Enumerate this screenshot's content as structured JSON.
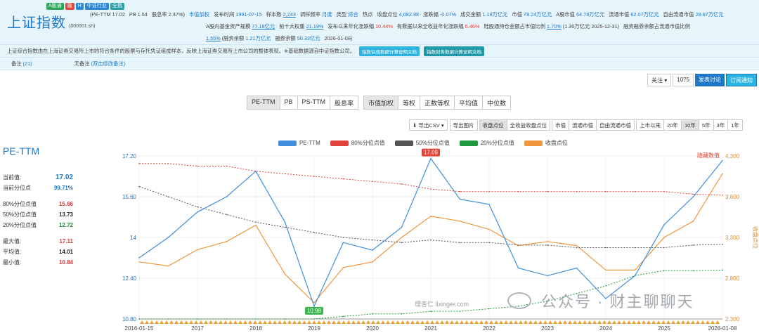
{
  "header": {
    "badges": [
      "A股通",
      "融",
      "H",
      "中证行业",
      "全指"
    ],
    "index_name": "上证指数",
    "index_code": "(000001.sh)",
    "row1": {
      "pe": "(PE-TTM 17.02",
      "pb": "PB 1.54",
      "div": "股息率 2.47%)",
      "weight": "市值加权",
      "publish_label": "发布时间",
      "publish": "1991-07-15",
      "samples_label": "样本数",
      "samples": "2,243",
      "rebal_label": "调样频率",
      "rebal": "月度",
      "type_label": "类型",
      "type": "综合",
      "hot": "热点",
      "close_label": "收盘点位",
      "close": "4,082.98",
      "chg_label": "涨跌幅",
      "chg": "-0.07%",
      "amount_label": "成交金额",
      "amount": "1.18万亿元",
      "mcap_label": "市值",
      "mcap": "78.24万亿元",
      "amcap_label": "A股市值",
      "amcap": "64.78万亿元",
      "float_label": "流通市值",
      "float": "62.07万亿元",
      "free_label": "自由流通市值",
      "free": "28.87万亿元"
    },
    "row2": {
      "fund_label": "A股内基金资产规模",
      "fund": "77.18亿元",
      "top10_label": "前十大权重",
      "top10": "21.19%",
      "annual_label": "发布以来年化涨跌幅",
      "annual": "10.44%",
      "total_label": "有数据以来全收益年化涨跌幅",
      "total": "6.46%",
      "hk_label": "陆股通持仓金额占市值比例",
      "hk": "1.70%",
      "hk_extra": "(1.30万亿元  2025-12-31)",
      "margin_label": "融资融券余额占流通市值比例"
    },
    "row3": {
      "ratio": "1.55%",
      "fin_label": "(融资余额",
      "fin": "1.21万亿元",
      "sec_label": "融券余额",
      "sec": "50.33亿元",
      "date": "2026-01-08)"
    },
    "description": "上证综合指数由在上海证券交易所上市的符合条件的股票与存托凭证组成样本，反映上海证券交易所上市公司的整体表现。※基础数据源自中证指数公司。",
    "doc_btn1": "指数估值数据计算说明文档",
    "doc_btn2": "指数财务数据计算说明文档",
    "note_label": "备注",
    "note_count": "(21)",
    "no_note_label": "无备注",
    "no_note_link": "(双击修改备注)"
  },
  "follow": {
    "label": "关注",
    "count": "1075",
    "discuss": "发表讨论",
    "subscribe": "订阅通知"
  },
  "metric_tabs": [
    "PE-TTM",
    "PB",
    "PS-TTM",
    "股息率"
  ],
  "weight_tabs": [
    "市值加权",
    "等权",
    "正数等权",
    "平均值",
    "中位数"
  ],
  "range_bar": {
    "export_csv": "导出CSV",
    "export_img": "导出图片",
    "price_opts": [
      "收盘点位",
      "全收益收盘点位"
    ],
    "cap_opts": [
      "市值",
      "流通市值",
      "自由流通市值"
    ],
    "periods": [
      "上市以来",
      "20年",
      "10年",
      "5年",
      "3年",
      "1年"
    ]
  },
  "left_stats": {
    "title": "PE-TTM",
    "current_label": "当前值:",
    "current": "17.02",
    "pct_label": "当前分位点",
    "pct": "99.71%",
    "p80_label": "80%分位点值",
    "p80": "15.66",
    "p50_label": "50%分位点值",
    "p50": "13.73",
    "p20_label": "20%分位点值",
    "p20": "12.72",
    "max_label": "最大值:",
    "max": "17.11",
    "avg_label": "平均值:",
    "avg": "14.01",
    "min_label": "最小值:",
    "min": "10.84"
  },
  "watermark": {
    "brand": "公众号 · 财主聊聊天",
    "source": "理杏仁 lixinger.com"
  },
  "colors": {
    "pe": "#3f8fdc",
    "p80": "#e0443a",
    "p50": "#555555",
    "p20": "#1e9a3c",
    "close": "#f0963c",
    "accent": "#1e78c8"
  },
  "chart_data": {
    "type": "line",
    "legend": [
      "PE-TTM",
      "80%分位点值",
      "50%分位点值",
      "20%分位点值",
      "收盘点位"
    ],
    "x": [
      "2016-01-15",
      "2016-07",
      "2017-01",
      "2017-07",
      "2018-01",
      "2018-07",
      "2019-01",
      "2019-07",
      "2020-01",
      "2020-07",
      "2021-01",
      "2021-07",
      "2022-01",
      "2022-07",
      "2023-01",
      "2023-07",
      "2024-01",
      "2024-07",
      "2025-01",
      "2025-07",
      "2026-01-08"
    ],
    "x_ticks": [
      "2016-01-15",
      "2017",
      "2018",
      "2019",
      "2020",
      "2021",
      "2022",
      "2023",
      "2024",
      "2025",
      "2026-01-08"
    ],
    "y_left_ticks": [
      "17.20",
      "15.60",
      "14",
      "12.40",
      "10.80"
    ],
    "y_left_range": [
      10.8,
      17.2
    ],
    "y_right_ticks": [
      "4,300",
      "3,800",
      "3,300",
      "2,800",
      "2,300"
    ],
    "y_right_range": [
      2300,
      4300
    ],
    "y_right_label": "收盘点位",
    "hidden_label": "隐藏数值",
    "max_label": "17.09",
    "min_label": "10.98",
    "series": [
      {
        "name": "PE-TTM",
        "axis": "left",
        "values": [
          13.2,
          14.0,
          15.0,
          15.6,
          16.6,
          14.6,
          11.3,
          13.8,
          13.5,
          14.4,
          17.1,
          15.5,
          15.3,
          12.8,
          12.5,
          12.8,
          11.6,
          12.5,
          14.5,
          15.6,
          17.02
        ]
      },
      {
        "name": "80%分位点值",
        "axis": "left",
        "values": [
          16.9,
          16.9,
          16.8,
          16.8,
          16.6,
          16.5,
          16.4,
          16.3,
          16.2,
          16.1,
          15.9,
          15.8,
          15.8,
          15.8,
          15.8,
          15.8,
          15.8,
          15.8,
          15.8,
          15.7,
          15.66
        ]
      },
      {
        "name": "50%分位点值",
        "axis": "left",
        "values": [
          16.0,
          15.6,
          15.2,
          14.9,
          14.6,
          14.4,
          14.2,
          14.0,
          13.9,
          13.8,
          13.9,
          13.8,
          13.8,
          13.7,
          13.7,
          13.6,
          13.6,
          13.6,
          13.6,
          13.7,
          13.73
        ]
      },
      {
        "name": "20%分位点值",
        "axis": "left",
        "values": [
          10.8,
          10.8,
          10.8,
          10.8,
          10.8,
          10.8,
          10.8,
          10.9,
          11.0,
          11.0,
          11.1,
          11.1,
          11.2,
          11.3,
          11.5,
          11.8,
          12.1,
          12.5,
          12.7,
          12.7,
          12.72
        ]
      },
      {
        "name": "收盘点位",
        "axis": "right",
        "values": [
          3000,
          2950,
          3150,
          3250,
          3450,
          2850,
          2500,
          2930,
          3000,
          3300,
          3560,
          3500,
          3400,
          3200,
          3250,
          3200,
          2900,
          2900,
          3300,
          3500,
          4083
        ]
      }
    ]
  }
}
